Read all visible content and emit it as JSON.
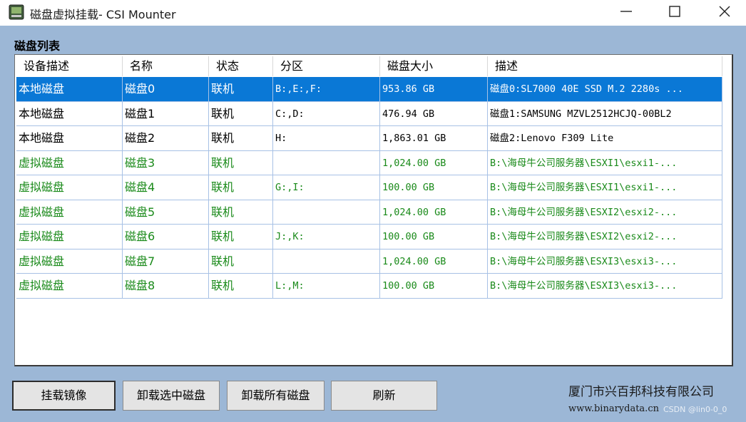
{
  "window": {
    "title": "磁盘虚拟挂载- CSI Mounter",
    "icon": "app-disk-icon",
    "controls": [
      "minimize-icon",
      "maximize-icon",
      "close-icon"
    ]
  },
  "section_label": "磁盘列表",
  "columns": [
    "设备描述",
    "名称",
    "状态",
    "分区",
    "磁盘大小",
    "描述"
  ],
  "rows": [
    {
      "type": "本地磁盘",
      "name": "磁盘0",
      "status": "联机",
      "partition": "B:,E:,F:",
      "size": "953.86 GB",
      "desc": "磁盘0:SL7000 40E SSD  M.2 2280s ...",
      "kind": "local",
      "selected": true
    },
    {
      "type": "本地磁盘",
      "name": "磁盘1",
      "status": "联机",
      "partition": "C:,D:",
      "size": "476.94 GB",
      "desc": "磁盘1:SAMSUNG MZVL2512HCJQ-00BL2",
      "kind": "local",
      "selected": false
    },
    {
      "type": "本地磁盘",
      "name": "磁盘2",
      "status": "联机",
      "partition": "H:",
      "size": "1,863.01 GB",
      "desc": "磁盘2:Lenovo F309 Lite",
      "kind": "local",
      "selected": false
    },
    {
      "type": "虚拟磁盘",
      "name": "磁盘3",
      "status": "联机",
      "partition": "",
      "size": "1,024.00 GB",
      "desc": "B:\\海母牛公司服务器\\ESXI1\\esxi1-...",
      "kind": "virtual",
      "selected": false
    },
    {
      "type": "虚拟磁盘",
      "name": "磁盘4",
      "status": "联机",
      "partition": "G:,I:",
      "size": "100.00 GB",
      "desc": "B:\\海母牛公司服务器\\ESXI1\\esxi1-...",
      "kind": "virtual",
      "selected": false
    },
    {
      "type": "虚拟磁盘",
      "name": "磁盘5",
      "status": "联机",
      "partition": "",
      "size": "1,024.00 GB",
      "desc": "B:\\海母牛公司服务器\\ESXI2\\esxi2-...",
      "kind": "virtual",
      "selected": false
    },
    {
      "type": "虚拟磁盘",
      "name": "磁盘6",
      "status": "联机",
      "partition": "J:,K:",
      "size": "100.00 GB",
      "desc": "B:\\海母牛公司服务器\\ESXI2\\esxi2-...",
      "kind": "virtual",
      "selected": false
    },
    {
      "type": "虚拟磁盘",
      "name": "磁盘7",
      "status": "联机",
      "partition": "",
      "size": "1,024.00 GB",
      "desc": "B:\\海母牛公司服务器\\ESXI3\\esxi3-...",
      "kind": "virtual",
      "selected": false
    },
    {
      "type": "虚拟磁盘",
      "name": "磁盘8",
      "status": "联机",
      "partition": "L:,M:",
      "size": "100.00 GB",
      "desc": "B:\\海母牛公司服务器\\ESXI3\\esxi3-...",
      "kind": "virtual",
      "selected": false
    }
  ],
  "buttons": {
    "mount": "挂载镜像",
    "unmount_selected": "卸载选中磁盘",
    "unmount_all": "卸载所有磁盘",
    "refresh": "刷新"
  },
  "footer": {
    "company": "厦门市兴百邦科技有限公司",
    "website": "www.binarydata.cn",
    "watermark": "CSDN @lin0-0_0"
  },
  "colors": {
    "window_bg": "#9cb7d6",
    "selected_row": "#0a78d6",
    "virtual_text": "#1a8a1a",
    "grid_line": "#a7c1e5"
  }
}
